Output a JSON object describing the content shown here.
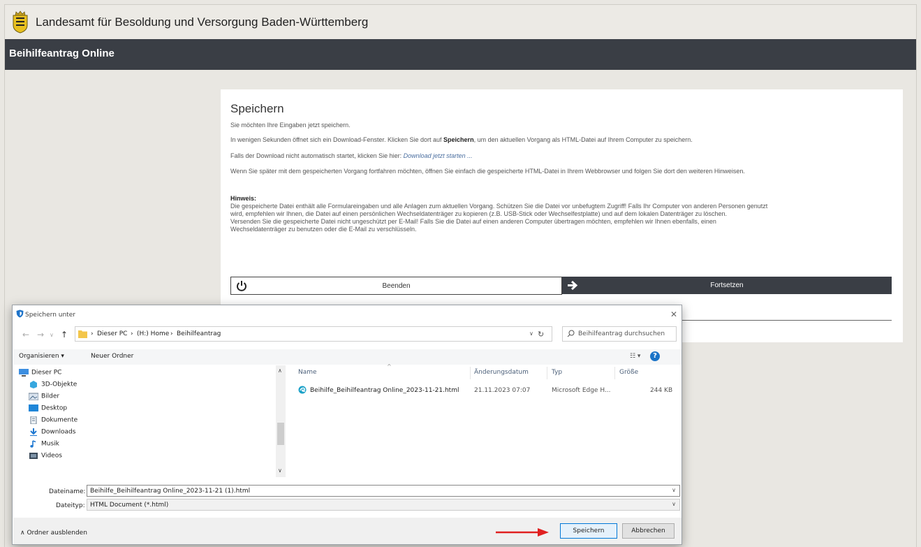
{
  "header": {
    "agency": "Landesamt für Besoldung und Versorgung Baden-Württemberg",
    "app_title": "Beihilfeantrag Online"
  },
  "card": {
    "title": "Speichern",
    "p1": "Sie möchten Ihre Eingaben jetzt speichern.",
    "p2_pre": "In wenigen Sekunden öffnet sich ein Download-Fenster. Klicken Sie dort auf",
    "p2_bold": "Speichern",
    "p2_post": ", um den aktuellen Vorgang als HTML-Datei auf Ihrem Computer zu speichern.",
    "p3_pre": "Falls der Download nicht automatisch startet, klicken Sie hier:",
    "p3_link": "Download jetzt starten ...",
    "p4": "Wenn Sie später mit dem gespeicherten Vorgang fortfahren möchten, öffnen Sie einfach die gespeicherte HTML-Datei in Ihrem Webbrowser und folgen Sie dort den weiteren Hinweisen.",
    "note_title": "Hinweis:",
    "note_p1": "Die gespeicherte Datei enthält alle Formulareingaben und alle Anlagen zum aktuellen Vorgang. Schützen Sie die Datei vor unbefugtem Zugriff! Falls Ihr Computer von anderen Personen genutzt wird, empfehlen wir Ihnen, die Datei auf einen persönlichen Wechseldatenträger zu kopieren (z.B. USB-Stick oder Wechselfestplatte) und auf dem lokalen Datenträger zu löschen.",
    "note_p2": "Versenden Sie die gespeicherte Datei nicht ungeschützt per E-Mail! Falls Sie die Datei auf einen anderen Computer übertragen möchten, empfehlen wir Ihnen ebenfalls, einen Wechseldatenträger zu benutzen oder die E-Mail zu verschlüsseln.",
    "btn_end": "Beenden",
    "btn_next": "Fortsetzen"
  },
  "dialog": {
    "title": "Speichern unter",
    "breadcrumb": [
      "Dieser PC",
      "(H:) Home",
      "Beihilfeantrag"
    ],
    "search_placeholder": "Beihilfeantrag durchsuchen",
    "toolbar": {
      "organize": "Organisieren ▾",
      "new_folder": "Neuer Ordner"
    },
    "tree": [
      "Dieser PC",
      "3D-Objekte",
      "Bilder",
      "Desktop",
      "Dokumente",
      "Downloads",
      "Musik",
      "Videos"
    ],
    "columns": {
      "name": "Name",
      "date": "Änderungsdatum",
      "type": "Typ",
      "size": "Größe"
    },
    "files": [
      {
        "name": "Beihilfe_Beihilfeantrag Online_2023-11-21.html",
        "date": "21.11.2023 07:07",
        "type": "Microsoft Edge H...",
        "size": "244 KB"
      }
    ],
    "filename_label": "Dateiname:",
    "filename_value": "Beihilfe_Beihilfeantrag Online_2023-11-21 (1).html",
    "filetype_label": "Dateityp:",
    "filetype_value": "HTML Document (*.html)",
    "hide_folders": "Ordner ausblenden",
    "save_button": "Speichern",
    "cancel_button": "Abbrechen"
  },
  "colors": {
    "appbar": "#3a3e45",
    "accent_blue": "#0078d7",
    "annotation_arrow": "#e02020"
  }
}
